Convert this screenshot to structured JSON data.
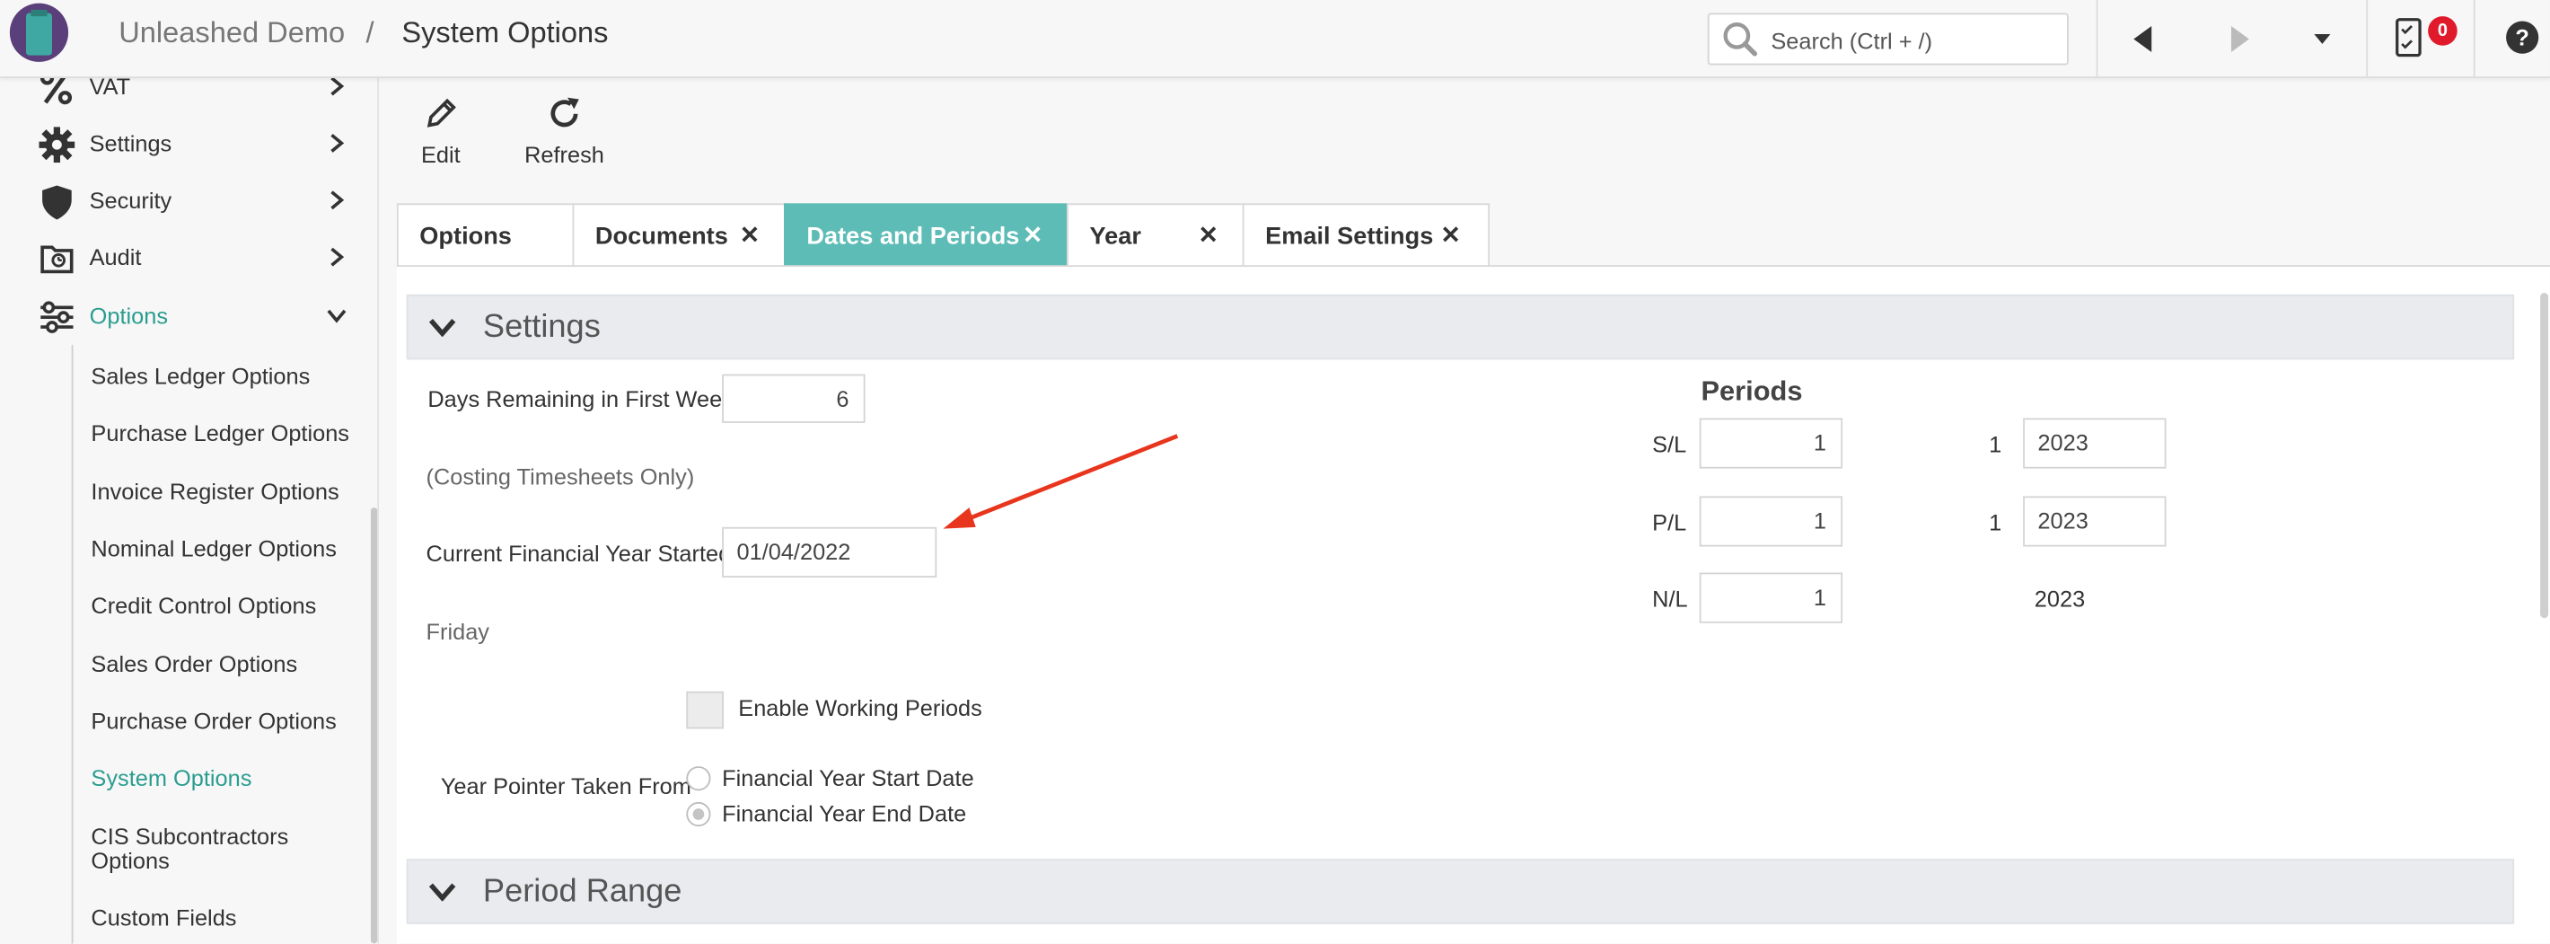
{
  "header": {
    "company": "Unleashed Demo",
    "separator": "/",
    "page_title": "System Options",
    "search_placeholder": "Search (Ctrl + /)",
    "notification_count": "0"
  },
  "sidebar": {
    "items": [
      {
        "label": "VAT",
        "icon": "percent-icon"
      },
      {
        "label": "Settings",
        "icon": "gear-icon"
      },
      {
        "label": "Security",
        "icon": "shield-icon"
      },
      {
        "label": "Audit",
        "icon": "audit-icon"
      },
      {
        "label": "Options",
        "icon": "sliders-icon",
        "expanded": true
      }
    ],
    "sub_items": [
      "Sales Ledger Options",
      "Purchase Ledger Options",
      "Invoice Register Options",
      "Nominal Ledger Options",
      "Credit Control Options",
      "Sales Order Options",
      "Purchase Order Options",
      "System Options",
      "CIS Subcontractors",
      "Options",
      "Custom Fields"
    ],
    "active_sub_item": "System Options"
  },
  "toolbar": {
    "edit_label": "Edit",
    "refresh_label": "Refresh"
  },
  "tabs": [
    {
      "label": "Options",
      "closable": false
    },
    {
      "label": "Documents",
      "closable": true
    },
    {
      "label": "Dates and Periods",
      "closable": true,
      "active": true
    },
    {
      "label": "Year",
      "closable": true
    },
    {
      "label": "Email Settings",
      "closable": true
    }
  ],
  "settings": {
    "section_title": "Settings",
    "days_remaining_label": "Days Remaining in First Week",
    "days_remaining_value": "6",
    "costing_note": "(Costing Timesheets Only)",
    "fy_started_label": "Current Financial Year Started",
    "fy_started_value": "01/04/2022",
    "fy_day": "Friday",
    "enable_working_periods_label": "Enable Working Periods",
    "enable_working_periods_checked": false,
    "year_pointer_label": "Year Pointer Taken From",
    "year_pointer_options": [
      "Financial Year Start Date",
      "Financial Year End Date"
    ],
    "year_pointer_selected": "Financial Year End Date"
  },
  "periods": {
    "title": "Periods",
    "rows": [
      {
        "ledger": "S/L",
        "period": "1",
        "index": "1",
        "year": "2023"
      },
      {
        "ledger": "P/L",
        "period": "1",
        "index": "1",
        "year": "2023"
      },
      {
        "ledger": "N/L",
        "period": "1",
        "index": "",
        "year": "2023"
      }
    ]
  },
  "period_range": {
    "section_title": "Period Range"
  },
  "colors": {
    "accent": "#5dbcb6",
    "active_link": "#2a9d8f",
    "badge": "#e0192b",
    "arrow": "#e8351d"
  }
}
